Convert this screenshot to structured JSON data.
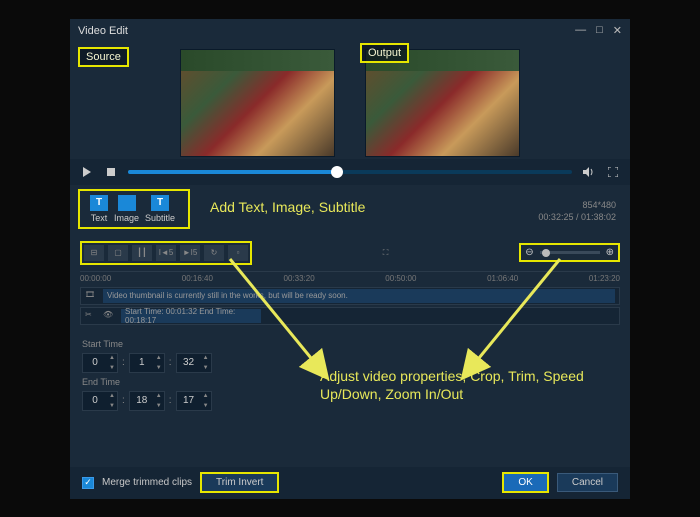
{
  "window": {
    "title": "Video Edit"
  },
  "labels": {
    "source": "Source",
    "output": "Output"
  },
  "tabs": {
    "text": "Text",
    "image": "Image",
    "subtitle": "Subtitle"
  },
  "annotations": {
    "tabs": "Add Text, Image, Subtitle",
    "main": "Adjust video properties, Crop, Trim, Speed Up/Down, Zoom In/Out"
  },
  "info": {
    "resolution": "854*480",
    "time_display": "00:32:25 / 01:38:02"
  },
  "toolbar": {
    "speed_down": "I◄5",
    "speed_up": "►I5"
  },
  "timeline": {
    "marks": [
      "00:00:00",
      "00:16:40",
      "00:33:20",
      "00:50:00",
      "01:06:40",
      "01:23:20"
    ],
    "thumbnail_msg": "Video thumbnail is currently still in the works, but will be ready soon.",
    "segment": "Start Time: 00:01:32   End Time: 00:18:17"
  },
  "fields": {
    "start_label": "Start Time",
    "end_label": "End Time",
    "start": {
      "h": "0",
      "m": "1",
      "s": "32"
    },
    "end": {
      "h": "0",
      "m": "18",
      "s": "17"
    }
  },
  "footer": {
    "merge": "Merge trimmed clips",
    "trim_invert": "Trim Invert",
    "ok": "OK",
    "cancel": "Cancel"
  }
}
